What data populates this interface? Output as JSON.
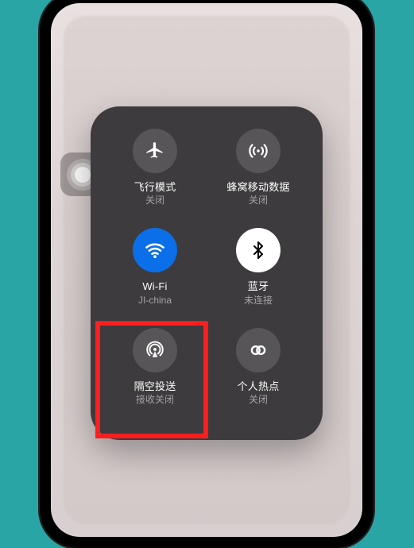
{
  "tiles": {
    "airplane": {
      "title": "飞行模式",
      "sub": "关闭"
    },
    "cellular": {
      "title": "蜂窝移动数据",
      "sub": "关闭"
    },
    "wifi": {
      "title": "Wi-Fi",
      "sub": "JI-china"
    },
    "bluetooth": {
      "title": "蓝牙",
      "sub": "未连接"
    },
    "airdrop": {
      "title": "隔空投送",
      "sub": "接收关闭"
    },
    "hotspot": {
      "title": "个人热点",
      "sub": "关闭"
    }
  }
}
